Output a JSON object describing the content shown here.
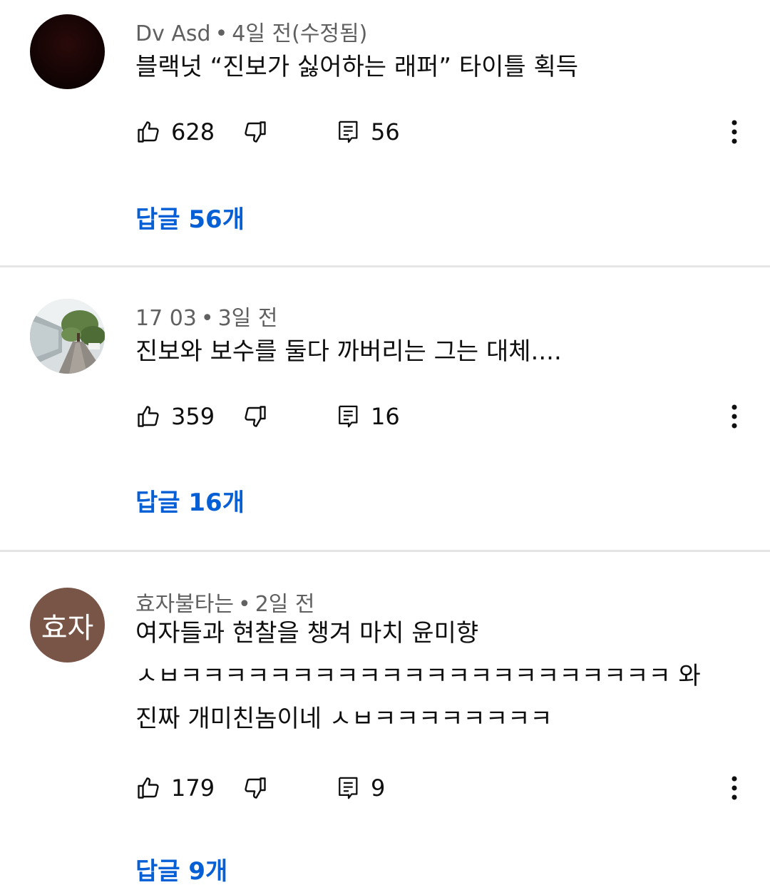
{
  "comments": [
    {
      "author": "Dv Asd",
      "time": "4일 전(수정됨)",
      "text_lines": [
        "블랙넛 “진보가 싫어하는 래퍼” 타이틀 획득"
      ],
      "likes": "628",
      "replies_count": "56",
      "replies_label": "답글 56개",
      "avatar": "dark-red-avatar"
    },
    {
      "author": "17 03",
      "time": "3일 전",
      "text_lines": [
        "진보와 보수를 둘다 까버리는 그는 대체...."
      ],
      "likes": "359",
      "replies_count": "16",
      "replies_label": "답글 16개",
      "avatar": "street-photo-avatar"
    },
    {
      "author": "효자불타는",
      "time": "2일 전",
      "avatar_initials": "효자",
      "avatar_color": "#795548",
      "text_lines": [
        "여자들과 현찰을 챙겨 마치 윤미향",
        "ㅅㅂㅋㅋㅋㅋㅋㅋㅋㅋㅋㅋㅋㅋㅋㅋㅋㅋㅋㅋㅋㅋㅋㅋ 와",
        "진짜 개미친놈이네 ㅅㅂㅋㅋㅋㅋㅋㅋㅋㅋ"
      ],
      "likes": "179",
      "replies_count": "9",
      "replies_label": "답글 9개"
    }
  ],
  "meta_separator": "•",
  "icons": {
    "like": "thumbs-up-icon",
    "dislike": "thumbs-down-icon",
    "reply": "comment-icon",
    "more": "more-vert-icon"
  },
  "colors": {
    "link": "#065fd4",
    "meta_text": "#606060",
    "divider": "#e5e5e5"
  }
}
